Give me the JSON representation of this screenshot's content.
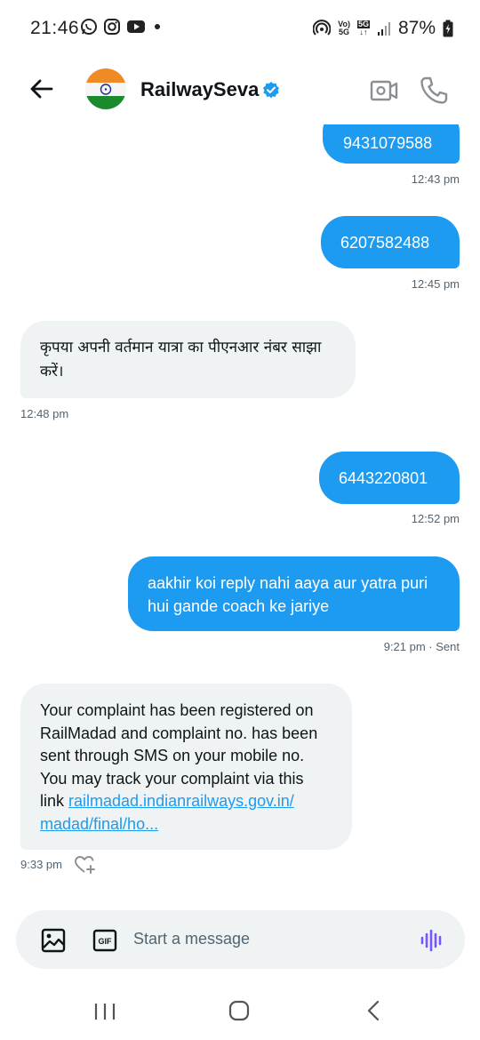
{
  "status_bar": {
    "time": "21:46",
    "battery": "87%",
    "net_top": "Vo)",
    "net_bottom": "5G",
    "net2_top": "5G",
    "net2_bottom": "↓↑"
  },
  "header": {
    "contact_name": "RailwaySeva",
    "verified": true,
    "accent_color": "#1d9bf0"
  },
  "messages": [
    {
      "direction": "out",
      "text": "9431079588",
      "time": "12:43 pm"
    },
    {
      "direction": "out",
      "text": "6207582488",
      "time": "12:45 pm"
    },
    {
      "direction": "in",
      "text": "कृपया अपनी वर्तमान यात्रा का पीएनआर नंबर साझा करें।",
      "line1": "कृपया अपनी वर्तमान यात्रा का पीएनआर नंबर साझा",
      "line2": "करें।",
      "time": "12:48 pm"
    },
    {
      "direction": "out",
      "text": "6443220801",
      "time": "12:52 pm"
    },
    {
      "direction": "out",
      "line1": "aakhir koi reply nahi aaya aur yatra puri",
      "line2": "hui gande coach ke jariye",
      "time": "9:21 pm · Sent"
    },
    {
      "direction": "in",
      "line1": "Your complaint has been registered on",
      "line2": "RailMadad and complaint no. has been",
      "line3": "sent through SMS on your mobile no.",
      "line4": "You may track your complaint via this",
      "line5_prefix": "link ",
      "link_part1": "railmadad.indianrailways.gov.in/",
      "link_part2": "madad/final/ho...",
      "time": "9:33 pm"
    }
  ],
  "compose": {
    "placeholder": "Start a message"
  },
  "icons": {
    "back": "arrow-left-icon",
    "video": "video-call-icon",
    "call": "phone-icon",
    "image": "image-icon",
    "gif": "gif-icon",
    "voice": "voice-wave-icon",
    "react": "heart-plus-icon"
  }
}
